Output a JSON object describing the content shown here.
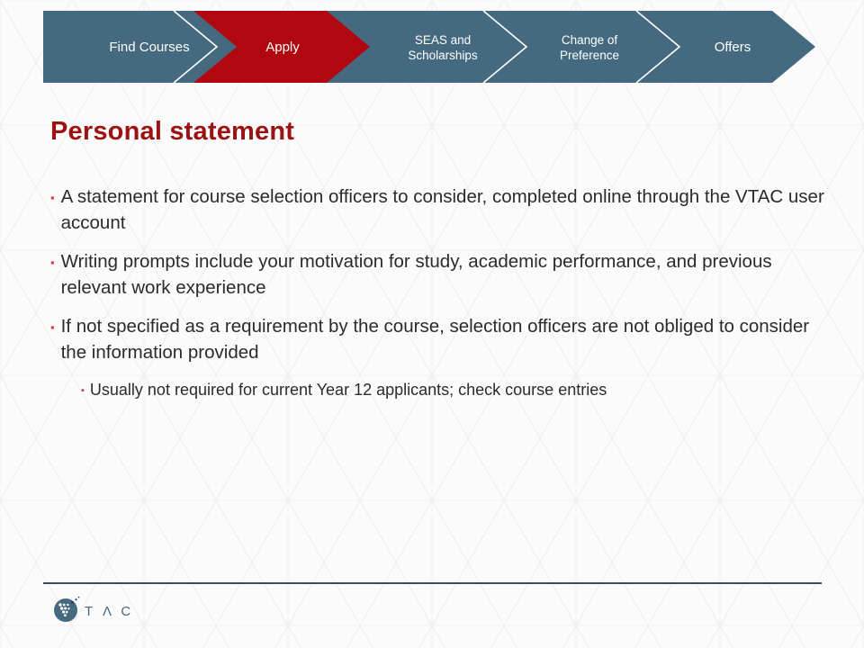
{
  "slide": {
    "title": "Personal statement",
    "title_color": "#9c1112",
    "background_color": "#fbfbfb",
    "body_text_color": "#2b2b2b",
    "bullet_marker_glyph": "▪",
    "bullet_marker_color": "#c0504d"
  },
  "process_banner": {
    "active_color": "#b00710",
    "inactive_color": "#456a80",
    "label_color": "#ffffff",
    "steps": [
      {
        "label_lines": [
          "Find Courses"
        ],
        "state": "inactive"
      },
      {
        "label_lines": [
          "Apply"
        ],
        "state": "active"
      },
      {
        "label_lines": [
          "SEAS and",
          "Scholarships"
        ],
        "state": "inactive"
      },
      {
        "label_lines": [
          "Change of",
          "Preference"
        ],
        "state": "inactive"
      },
      {
        "label_lines": [
          "Offers"
        ],
        "state": "inactive"
      }
    ]
  },
  "bullets": [
    {
      "level": 1,
      "text": "A statement for course selection officers to consider, completed online through the VTAC user account"
    },
    {
      "level": 1,
      "text": "Writing prompts include your motivation for study, academic performance, and previous relevant work experience"
    },
    {
      "level": 1,
      "text": "If not specified as a requirement by the course, selection officers are not obliged to consider the information provided"
    },
    {
      "level": 2,
      "text": "Usually not required for current Year 12 applicants; check course entries"
    }
  ],
  "footer": {
    "logo_text": "T Λ C",
    "logo_color": "#456a80",
    "divider_color": "#3f4c5c"
  }
}
